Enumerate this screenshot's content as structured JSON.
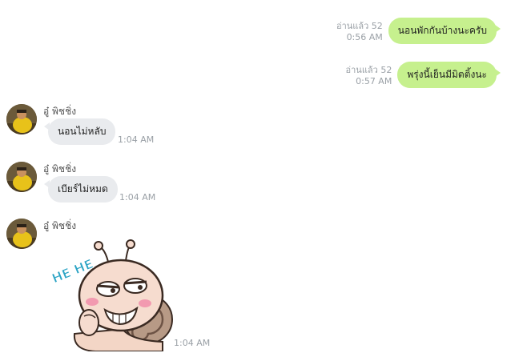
{
  "outgoing": [
    {
      "read": "อ่านแล้ว 52",
      "time": "0:56 AM",
      "text": "นอนพักกันบ้างนะครับ"
    },
    {
      "read": "อ่านแล้ว 52",
      "time": "0:57 AM",
      "text": "พรุ่งนี้เย็นมีมิตติ้งนะ"
    }
  ],
  "incoming": [
    {
      "sender": "อู๋ พิชชิ่ง",
      "text": "นอนไม่หลับ",
      "time": "1:04 AM"
    },
    {
      "sender": "อู๋ พิชชิ่ง",
      "text": "เบียร์ไม่หมด",
      "time": "1:04 AM"
    },
    {
      "sender": "อู๋ พิชชิ่ง",
      "sticker_text": "HE HE",
      "time": "1:04 AM"
    }
  ],
  "colors": {
    "outgoing_bubble": "#c6f08e",
    "incoming_bubble": "#e9ebee",
    "meta_text": "#9aa0a6"
  }
}
